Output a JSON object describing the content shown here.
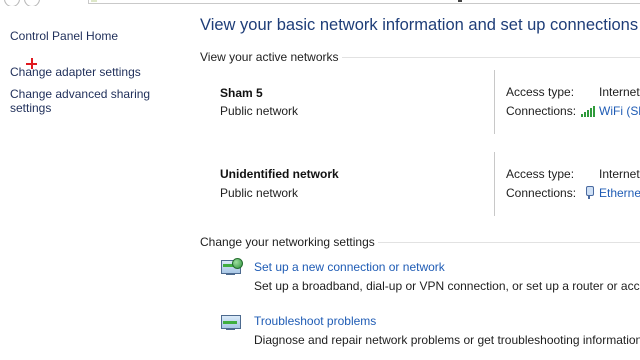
{
  "left_pane": {
    "home_link": "Control Panel Home",
    "adapter_link": "Change adapter settings",
    "sharing_link_line1": "Change advanced sharing",
    "sharing_link_line2": "settings"
  },
  "main": {
    "title": "View your basic network information and set up connections",
    "active_networks_heading": "View your active networks",
    "networks": [
      {
        "name": "Sham  5",
        "category": "Public network",
        "access_type_label": "Access type:",
        "access_type_value": "Internet",
        "connections_label": "Connections:",
        "connections_value": "WiFi (Sh",
        "connection_icon": "wifi-signal-icon"
      },
      {
        "name": "Unidentified network",
        "category": "Public network",
        "access_type_label": "Access type:",
        "access_type_value": "Internet",
        "connections_label": "Connections:",
        "connections_value": "Ethernet",
        "connection_icon": "ethernet-icon"
      }
    ],
    "settings_heading": "Change your networking settings",
    "tasks": [
      {
        "link": "Set up a new connection or network",
        "description": "Set up a broadband, dial-up or VPN connection, or set up a router or access",
        "icon": "new-connection-icon"
      },
      {
        "link": "Troubleshoot problems",
        "description": "Diagnose and repair network problems or get troubleshooting information.",
        "icon": "troubleshoot-icon"
      }
    ]
  },
  "colors": {
    "title": "#1e3d78",
    "link": "#1f5cb5",
    "wifi_signal": "#2f9b3b",
    "cursor": "#e0191f"
  }
}
